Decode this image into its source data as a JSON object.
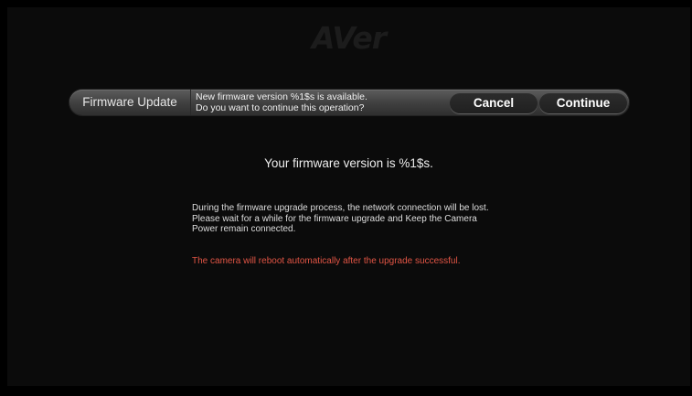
{
  "brand": {
    "logo_text": "AVer"
  },
  "toolbar": {
    "title": "Firmware Update",
    "message_line1": "New firmware version %1$s is available.",
    "message_line2": "Do you want to continue this operation?",
    "cancel_label": "Cancel",
    "continue_label": "Continue"
  },
  "content": {
    "version_text": "Your firmware version is %1$s.",
    "info_lines": [
      "During the firmware upgrade process, the network connection will be lost.",
      "Please wait for a while for the firmware upgrade and Keep the Camera",
      "Power remain connected."
    ],
    "warning_text": "The camera will reboot automatically after the upgrade successful.",
    "warning_color": "#e25545"
  }
}
